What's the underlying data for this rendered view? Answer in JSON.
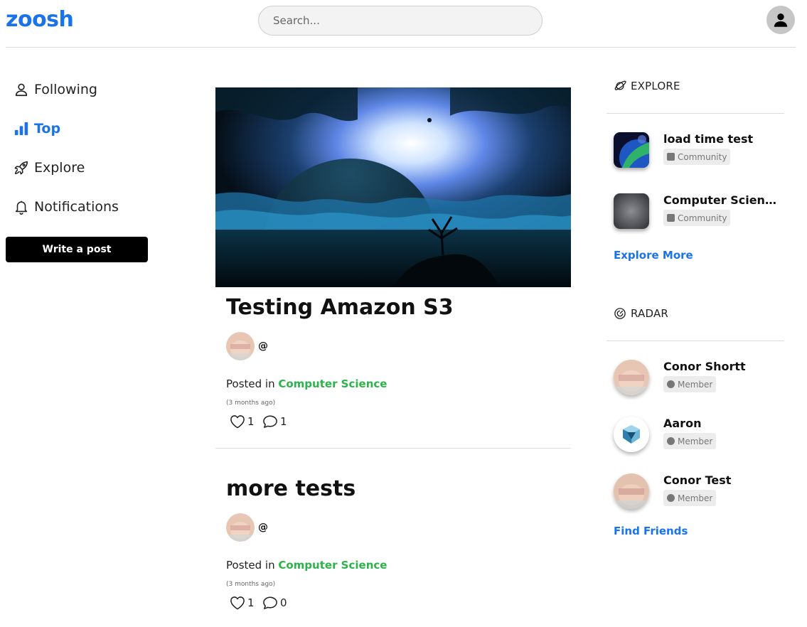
{
  "header": {
    "logo": "zoosh",
    "search_placeholder": "Search..."
  },
  "nav": {
    "items": [
      {
        "label": "Following",
        "icon": "user-icon",
        "active": false
      },
      {
        "label": "Top",
        "icon": "bar-chart-icon",
        "active": true
      },
      {
        "label": "Explore",
        "icon": "rocket-icon",
        "active": false
      },
      {
        "label": "Notifications",
        "icon": "bell-icon",
        "active": false
      }
    ],
    "write_label": "Write a post"
  },
  "posts": [
    {
      "title": "Testing Amazon S3",
      "author_handle": "@",
      "posted_in_prefix": "Posted in",
      "category": "Computer Science",
      "time": "(3 months ago)",
      "likes": "1",
      "comments": "1",
      "has_image": true
    },
    {
      "title": "more tests",
      "author_handle": "@",
      "posted_in_prefix": "Posted in",
      "category": "Computer Science",
      "time": "(3 months ago)",
      "likes": "1",
      "comments": "0",
      "has_image": false
    }
  ],
  "explore": {
    "heading": "EXPLORE",
    "items": [
      {
        "name": "load time test",
        "badge": "Community"
      },
      {
        "name": "Computer Scienc...",
        "badge": "Community"
      }
    ],
    "more_label": "Explore More"
  },
  "radar": {
    "heading": "RADAR",
    "items": [
      {
        "name": "Conor Shortt",
        "badge": "Member"
      },
      {
        "name": "Aaron",
        "badge": "Member"
      },
      {
        "name": "Conor Test",
        "badge": "Member"
      }
    ],
    "more_label": "Find Friends"
  },
  "colors": {
    "accent": "#1a73e8",
    "category": "#2cb34a",
    "badge_bg": "#ececec"
  }
}
